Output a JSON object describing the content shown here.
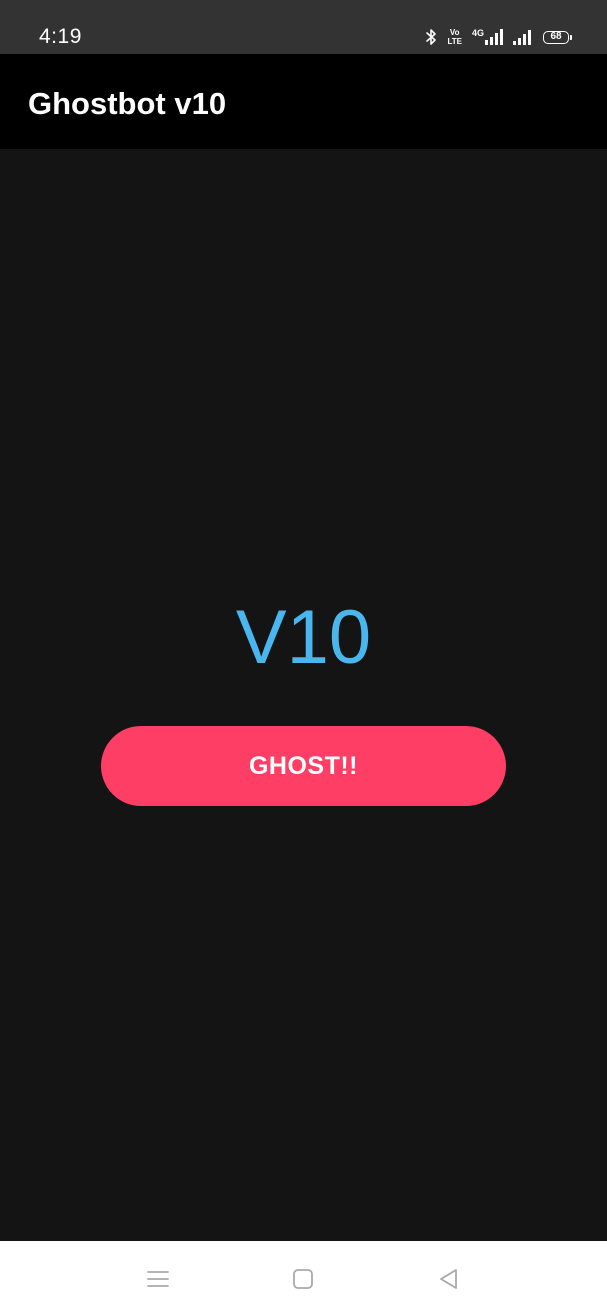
{
  "status_bar": {
    "time": "4:19",
    "icons": [
      "bluetooth-icon",
      "volte-icon",
      "signal-4g-icon",
      "signal-icon",
      "battery-icon"
    ],
    "volte_line1": "Vo",
    "volte_line2": "LTE",
    "network_type": "4G",
    "battery_level": "68"
  },
  "app_bar": {
    "title": "Ghostbot v10"
  },
  "main": {
    "version_label": "V10",
    "ghost_button_label": "GHOST!!"
  },
  "nav_bar": {
    "icons": [
      "recents-icon",
      "home-icon",
      "back-icon"
    ]
  },
  "colors": {
    "status_bar_bg": "#333333",
    "app_bar_bg": "#000000",
    "background": "#141414",
    "accent_text": "#4ab6ee",
    "button": "#ff3e66",
    "nav_bar_bg": "#ffffff"
  }
}
